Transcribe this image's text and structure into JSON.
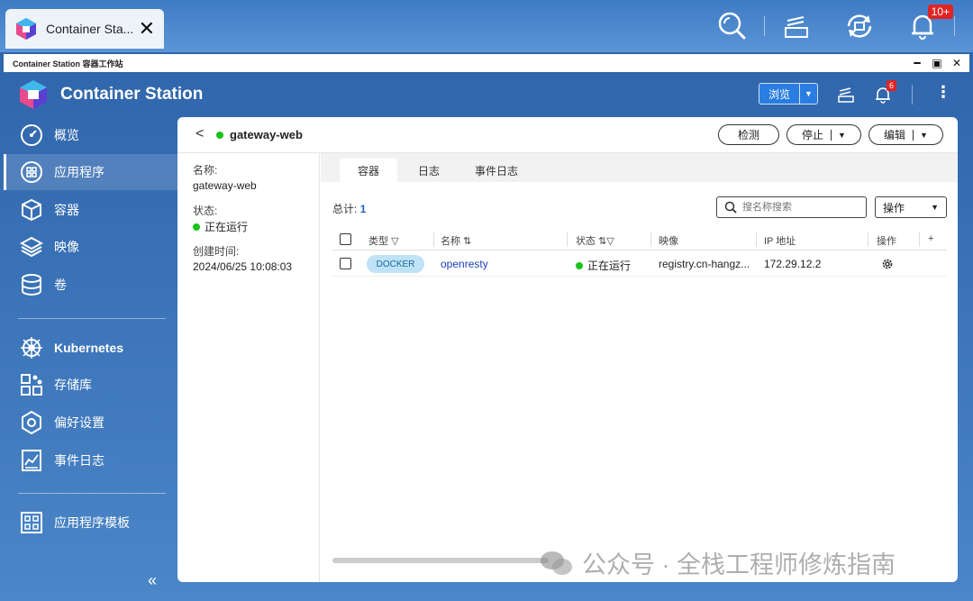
{
  "os": {
    "tab_title": "Container Sta...",
    "notification_badge": "10+"
  },
  "window": {
    "title": "Container Station 容器工作站"
  },
  "header": {
    "app_title": "Container Station",
    "browse_label": "浏览",
    "notification_badge": "6"
  },
  "sidebar": {
    "items": [
      {
        "label": "概览",
        "icon": "dashboard-icon"
      },
      {
        "label": "应用程序",
        "icon": "apps-icon"
      },
      {
        "label": "容器",
        "icon": "container-icon"
      },
      {
        "label": "映像",
        "icon": "layers-icon"
      },
      {
        "label": "卷",
        "icon": "database-icon"
      },
      {
        "label": "Kubernetes",
        "icon": "kubernetes-icon"
      },
      {
        "label": "存储库",
        "icon": "repository-icon"
      },
      {
        "label": "偏好设置",
        "icon": "settings-icon"
      },
      {
        "label": "事件日志",
        "icon": "event-log-icon"
      },
      {
        "label": "应用程序模板",
        "icon": "template-icon"
      }
    ],
    "active_index": 1
  },
  "detail": {
    "name": "gateway-web",
    "status_color": "#18c418",
    "buttons": {
      "check": "检测",
      "stop": "停止",
      "edit": "编辑"
    },
    "info": {
      "name_label": "名称:",
      "name_value": "gateway-web",
      "status_label": "状态:",
      "status_value": "正在运行",
      "created_label": "创建时间:",
      "created_value": "2024/06/25 10:08:03"
    },
    "tabs": [
      "容器",
      "日志",
      "事件日志"
    ],
    "active_tab": 0,
    "total_label": "总计:",
    "total_value": "1",
    "search_placeholder": "搜名称搜索",
    "ops_label": "操作",
    "table": {
      "columns": [
        "类型",
        "名称",
        "状态",
        "映像",
        "IP 地址",
        "操作",
        "+"
      ],
      "rows": [
        {
          "type": "DOCKER",
          "name": "openresty",
          "status": "正在运行",
          "image": "registry.cn-hangz...",
          "ip": "172.29.12.2"
        }
      ]
    }
  },
  "watermark": "公众号 · 全栈工程师修炼指南",
  "colors": {
    "accent": "#2a7de1",
    "running": "#18c418",
    "badge": "#e02424"
  }
}
